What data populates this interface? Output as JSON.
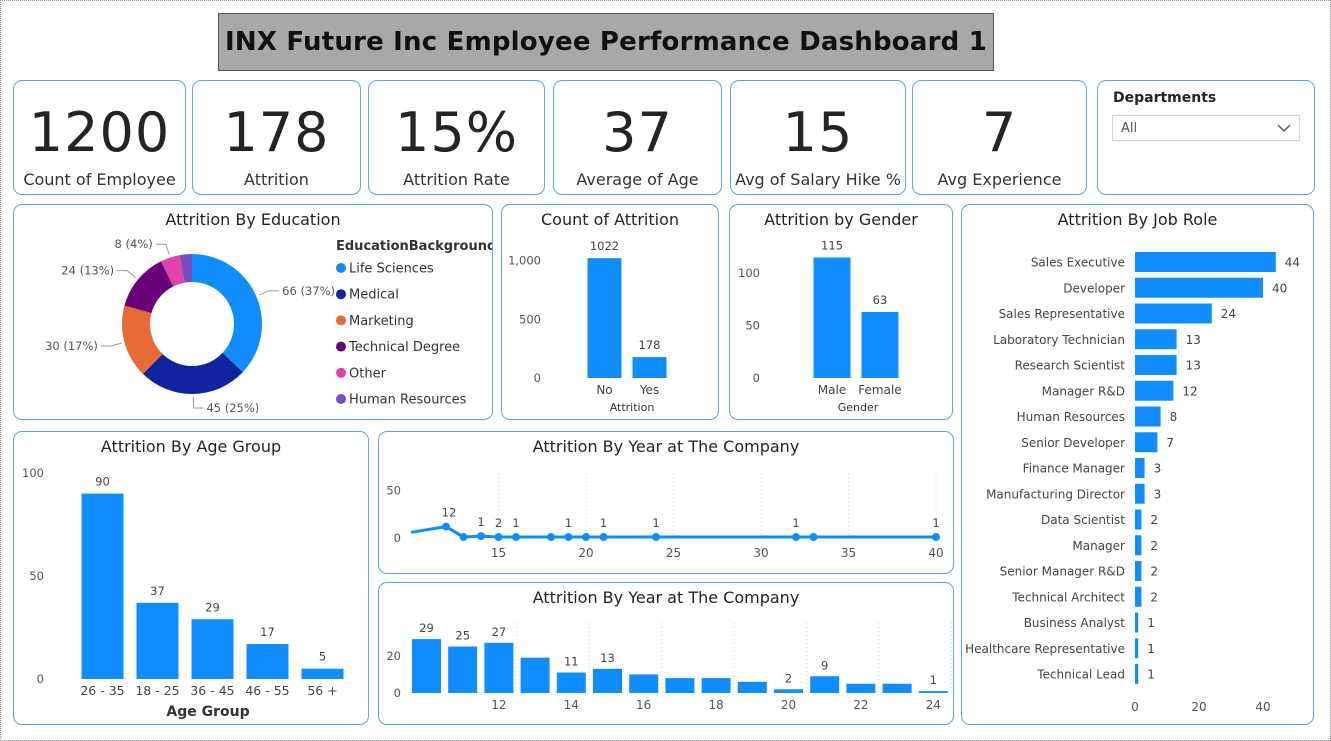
{
  "header": {
    "title": "INX Future Inc Employee Performance Dashboard 1"
  },
  "kpis": [
    {
      "value": "1200",
      "label": "Count of Employee"
    },
    {
      "value": "178",
      "label": "Attrition"
    },
    {
      "value": "15%",
      "label": "Attrition Rate"
    },
    {
      "value": "37",
      "label": "Average of Age"
    },
    {
      "value": "15",
      "label": "Avg of Salary Hike %"
    },
    {
      "value": "7",
      "label": "Avg Experience"
    }
  ],
  "slicer": {
    "title": "Departments",
    "value": "All",
    "icon": "chevron-down-icon"
  },
  "colors": {
    "accent": "#118DFF",
    "border": "#5AA6E0",
    "education": [
      "#118DFF",
      "#12239E",
      "#E66C37",
      "#6B007B",
      "#E044A7",
      "#744EC2"
    ]
  },
  "chart_data": [
    {
      "type": "pie",
      "variant": "donut",
      "title": "Attrition By Education",
      "legend_title": "EducationBackground",
      "categories": [
        "Life Sciences",
        "Medical",
        "Marketing",
        "Technical Degree",
        "Other",
        "Human Resources"
      ],
      "values": [
        66,
        45,
        30,
        24,
        8,
        5
      ],
      "data_labels": [
        "66 (37%)",
        "45 (25%)",
        "30 (17%)",
        "24 (13%)",
        "8 (4%)",
        ""
      ],
      "legend_position": "right"
    },
    {
      "type": "bar",
      "title": "Count of Attrition",
      "categories": [
        "No",
        "Yes"
      ],
      "values": [
        1022,
        178
      ],
      "xlabel": "Attrition",
      "ylabel": "",
      "ylim": [
        0,
        1100
      ],
      "yticks": [
        {
          "v": 0,
          "t": "0"
        },
        {
          "v": 500,
          "t": "500"
        },
        {
          "v": 1000,
          "t": "1,000"
        }
      ]
    },
    {
      "type": "bar",
      "title": "Attrition by Gender",
      "categories": [
        "Male",
        "Female"
      ],
      "values": [
        115,
        63
      ],
      "xlabel": "Gender",
      "ylabel": "",
      "ylim": [
        0,
        125
      ],
      "yticks": [
        {
          "v": 0,
          "t": "0"
        },
        {
          "v": 50,
          "t": "50"
        },
        {
          "v": 100,
          "t": "100"
        }
      ]
    },
    {
      "type": "bar",
      "orientation": "horizontal",
      "title": "Attrition By Job Role",
      "categories": [
        "Sales Executive",
        "Developer",
        "Sales Representative",
        "Laboratory Technician",
        "Research Scientist",
        "Manager R&D",
        "Human Resources",
        "Senior Developer",
        "Finance Manager",
        "Manufacturing Director",
        "Data Scientist",
        "Manager",
        "Senior Manager R&D",
        "Technical Architect",
        "Business Analyst",
        "Healthcare Representative",
        "Technical Lead"
      ],
      "values": [
        44,
        40,
        24,
        13,
        13,
        12,
        8,
        7,
        3,
        3,
        2,
        2,
        2,
        2,
        1,
        1,
        1
      ],
      "xlim": [
        0,
        50
      ],
      "xticks": [
        {
          "v": 0,
          "t": "0"
        },
        {
          "v": 20,
          "t": "20"
        },
        {
          "v": 40,
          "t": "40"
        }
      ]
    },
    {
      "type": "bar",
      "title": "Attrition By Age Group",
      "categories": [
        "26 - 35",
        "18 - 25",
        "36 - 45",
        "46 - 55",
        "56 +"
      ],
      "values": [
        90,
        37,
        29,
        17,
        5
      ],
      "xlabel": "Age Group",
      "ylabel": "",
      "ylim": [
        0,
        100
      ],
      "yticks": [
        {
          "v": 0,
          "t": "0"
        },
        {
          "v": 50,
          "t": "50"
        },
        {
          "v": 100,
          "t": "100"
        }
      ]
    },
    {
      "type": "line",
      "title": "Attrition By Year at The Company",
      "x": [
        10,
        12,
        13,
        14,
        15,
        16,
        18,
        19,
        20,
        21,
        24,
        32,
        33,
        40
      ],
      "y": [
        6,
        12,
        1,
        2,
        1,
        1,
        1,
        1,
        1,
        1,
        1,
        1,
        1,
        1
      ],
      "point_labels": {
        "12": "12",
        "14": "1",
        "15": "2",
        "16": "1",
        "19": "1",
        "21": "1",
        "24": "1",
        "32": "1",
        "40": "1"
      },
      "xlim": [
        10,
        40
      ],
      "ylim": [
        0,
        60
      ],
      "xticks": [
        {
          "v": 15,
          "t": "15"
        },
        {
          "v": 20,
          "t": "20"
        },
        {
          "v": 25,
          "t": "25"
        },
        {
          "v": 30,
          "t": "30"
        },
        {
          "v": 35,
          "t": "35"
        },
        {
          "v": 40,
          "t": "40"
        }
      ],
      "yticks": [
        {
          "v": 0,
          "t": "0"
        },
        {
          "v": 50,
          "t": "50"
        }
      ]
    },
    {
      "type": "bar",
      "title": "Attrition By Year at The Company",
      "x": [
        10,
        11,
        12,
        13,
        14,
        15,
        16,
        17,
        18,
        19,
        20,
        21,
        22,
        23,
        24,
        25
      ],
      "values": [
        29,
        25,
        27,
        19,
        11,
        13,
        10,
        8,
        8,
        6,
        2,
        9,
        5,
        5,
        1
      ],
      "data_labels": [
        "29",
        "25",
        "27",
        "",
        "11",
        "13",
        "",
        "",
        "",
        "",
        "2",
        "9",
        "",
        "",
        "1"
      ],
      "ylim": [
        0,
        35
      ],
      "xticks": [
        {
          "v": 12,
          "t": "12"
        },
        {
          "v": 14,
          "t": "14"
        },
        {
          "v": 16,
          "t": "16"
        },
        {
          "v": 18,
          "t": "18"
        },
        {
          "v": 20,
          "t": "20"
        },
        {
          "v": 22,
          "t": "22"
        },
        {
          "v": 24,
          "t": "24"
        }
      ],
      "yticks": [
        {
          "v": 0,
          "t": "0"
        },
        {
          "v": 20,
          "t": "20"
        }
      ]
    }
  ]
}
